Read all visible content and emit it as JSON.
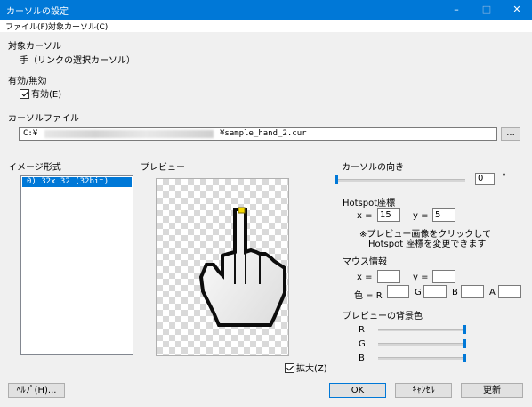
{
  "window": {
    "title": "カーソルの設定",
    "controls": {
      "minimize": "–",
      "maximize": "□",
      "close": "✕"
    }
  },
  "menu": {
    "items": [
      "ファイル(F)",
      "対象カーソル(C)"
    ]
  },
  "target_cursor": {
    "heading": "対象カーソル",
    "value": "手（リンクの選択カーソル）"
  },
  "enabled": {
    "heading": "有効/無効",
    "checkbox_label": "有効(E)",
    "checked": true
  },
  "cursor_file": {
    "heading": "カーソルファイル",
    "path_prefix": "C:¥",
    "path_suffix": "¥sample_hand_2.cur",
    "browse_label": "..."
  },
  "image_format": {
    "heading": "イメージ形式",
    "items": [
      "0)  32x 32 (32bit)"
    ],
    "selected_index": 0
  },
  "preview": {
    "heading": "プレビュー",
    "zoom_label": "拡大(Z)",
    "zoom_checked": true
  },
  "direction": {
    "heading": "カーソルの向き",
    "value": "0",
    "unit": "°"
  },
  "hotspot": {
    "heading": "Hotspot座標",
    "x_label": "x =",
    "x_value": "15",
    "y_label": "y =",
    "y_value": "5",
    "note_line1": "※プレビュー画像をクリックして",
    "note_line2": "Hotspot 座標を変更できます"
  },
  "mouse_info": {
    "heading": "マウス情報",
    "x_label": "x =",
    "y_label": "y =",
    "color_label": "色 = R",
    "g_label": "G",
    "b_label": "B",
    "a_label": "A"
  },
  "bg_color": {
    "heading": "プレビューの背景色",
    "r_label": "R",
    "g_label": "G",
    "b_label": "B",
    "r": 255,
    "g": 255,
    "b": 255
  },
  "buttons": {
    "help": "ﾍﾙﾌﾟ(H)...",
    "ok": "OK",
    "cancel": "ｷｬﾝｾﾙ",
    "update": "更新"
  },
  "colors": {
    "accent": "#0078d7",
    "hotspot": "#f5d800"
  }
}
